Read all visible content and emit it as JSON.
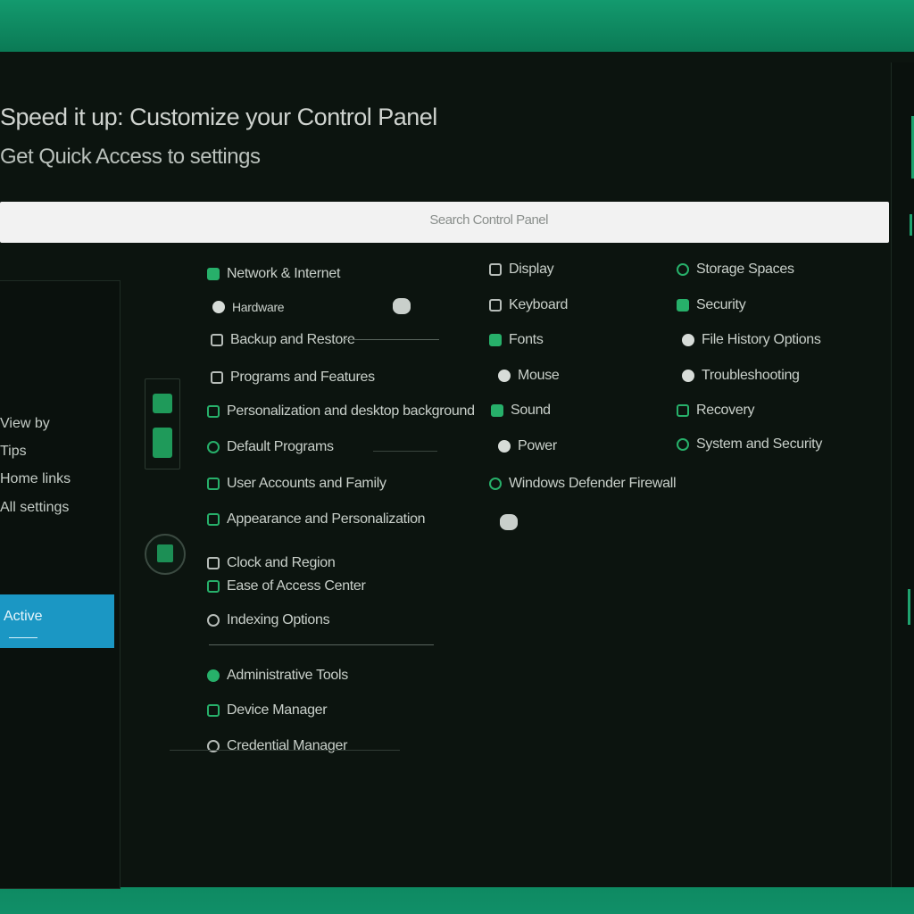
{
  "header": {
    "title": "Speed it up: Customize your Control Panel",
    "subtitle": "Get Quick Access to settings"
  },
  "search": {
    "hint": "Search Control Panel"
  },
  "sidebar": {
    "items": [
      {
        "label": "View by"
      },
      {
        "label": "Tips"
      },
      {
        "label": "Home links"
      },
      {
        "label": "All settings"
      },
      {
        "label": "Active"
      }
    ]
  },
  "columns": {
    "col1": [
      {
        "label": "Network & Internet",
        "icon": "network-icon"
      },
      {
        "label": "Hardware",
        "icon": "hardware-icon"
      },
      {
        "label": "Backup and Restore",
        "icon": "backup-icon"
      },
      {
        "label": "Programs and Features",
        "icon": "programs-icon"
      },
      {
        "label": "Personalization and desktop background",
        "icon": "personalize-icon"
      },
      {
        "label": "Default Programs",
        "icon": "defaults-icon"
      },
      {
        "label": "User Accounts and Family",
        "icon": "users-icon"
      },
      {
        "label": "Appearance and Personalization",
        "icon": "appearance-icon"
      },
      {
        "label": "Clock and Region",
        "icon": "clock-icon"
      },
      {
        "label": "Ease of Access Center",
        "icon": "access-icon"
      },
      {
        "label": "Indexing Options",
        "icon": "index-icon"
      },
      {
        "label": "Administrative Tools",
        "icon": "admin-icon"
      },
      {
        "label": "Device Manager",
        "icon": "device-icon"
      },
      {
        "label": "Credential Manager",
        "icon": "credential-icon"
      }
    ],
    "col2": [
      {
        "label": "Display",
        "icon": "display-icon"
      },
      {
        "label": "Keyboard",
        "icon": "keyboard-icon"
      },
      {
        "label": "Fonts",
        "icon": "fonts-icon"
      },
      {
        "label": "Mouse",
        "icon": "mouse-icon"
      },
      {
        "label": "Sound",
        "icon": "sound-icon"
      },
      {
        "label": "Power",
        "icon": "power-icon"
      },
      {
        "label": "Windows Defender Firewall",
        "icon": "firewall-icon"
      }
    ],
    "col3": [
      {
        "label": "Storage Spaces",
        "icon": "storage-icon"
      },
      {
        "label": "Security",
        "icon": "security-icon"
      },
      {
        "label": "File History Options",
        "icon": "history-icon"
      },
      {
        "label": "Troubleshooting",
        "icon": "troubleshoot-icon"
      },
      {
        "label": "Recovery",
        "icon": "recovery-icon"
      },
      {
        "label": "System and Security",
        "icon": "system-icon"
      }
    ]
  }
}
